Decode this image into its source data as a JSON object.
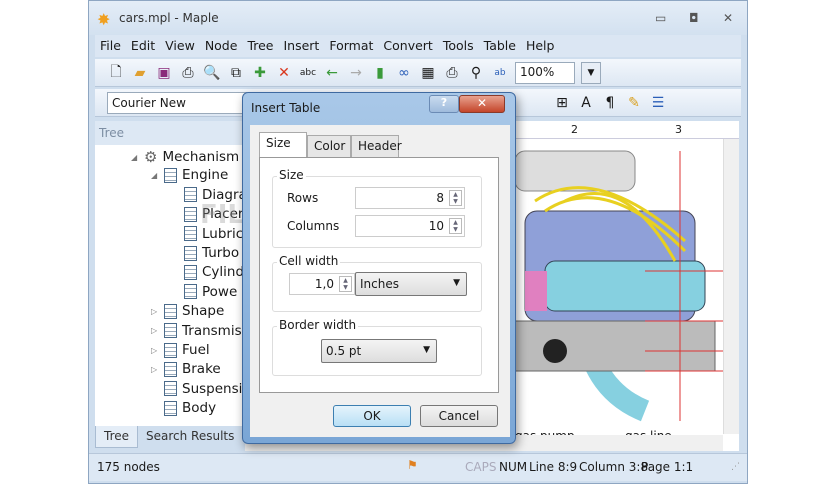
{
  "window": {
    "title": "cars.mpl - Maple"
  },
  "menu": [
    "File",
    "Edit",
    "View",
    "Node",
    "Tree",
    "Insert",
    "Format",
    "Convert",
    "Tools",
    "Table",
    "Help"
  ],
  "toolbar": {
    "zoom": "100%",
    "font": "Courier New"
  },
  "tree": {
    "header": "Tree",
    "nodes": [
      {
        "label": "Mechanism",
        "level": 0,
        "icon": "gear-icon",
        "expanded": true
      },
      {
        "label": "Engine",
        "level": 1,
        "expanded": true
      },
      {
        "label": "Diagra",
        "level": 2
      },
      {
        "label": "Placer",
        "level": 2
      },
      {
        "label": "Lubric",
        "level": 2
      },
      {
        "label": "Turbo",
        "level": 2
      },
      {
        "label": "Cylind",
        "level": 2
      },
      {
        "label": "Powe",
        "level": 2
      },
      {
        "label": "Shape",
        "level": 1,
        "collapsed": true
      },
      {
        "label": "Transmis",
        "level": 1,
        "collapsed": true
      },
      {
        "label": "Fuel",
        "level": 1,
        "collapsed": true
      },
      {
        "label": "Brake",
        "level": 1,
        "collapsed": true
      },
      {
        "label": "Suspensi",
        "level": 1
      },
      {
        "label": "Body",
        "level": 1
      }
    ],
    "tabs": [
      "Tree",
      "Search Results"
    ]
  },
  "ruler": [
    "2",
    "3"
  ],
  "doc": {
    "labels": [
      "gas pump",
      "gas line"
    ]
  },
  "status": {
    "nodes": "175 nodes",
    "caps": "CAPS",
    "num": "NUM",
    "line": "Line 8:9",
    "column": "Column 3:8",
    "page": "Page 1:1"
  },
  "dialog": {
    "title": "Insert Table",
    "help": "?",
    "tabs": [
      "Size",
      "Color",
      "Header"
    ],
    "size_group": "Size",
    "rows_label": "Rows",
    "rows": "8",
    "columns_label": "Columns",
    "columns": "10",
    "cell_group": "Cell width",
    "cell_width": "1,0",
    "cell_unit": "Inches",
    "border_group": "Border width",
    "border_width": "0.5 pt",
    "ok": "OK",
    "cancel": "Cancel"
  },
  "watermark": "FILECR"
}
